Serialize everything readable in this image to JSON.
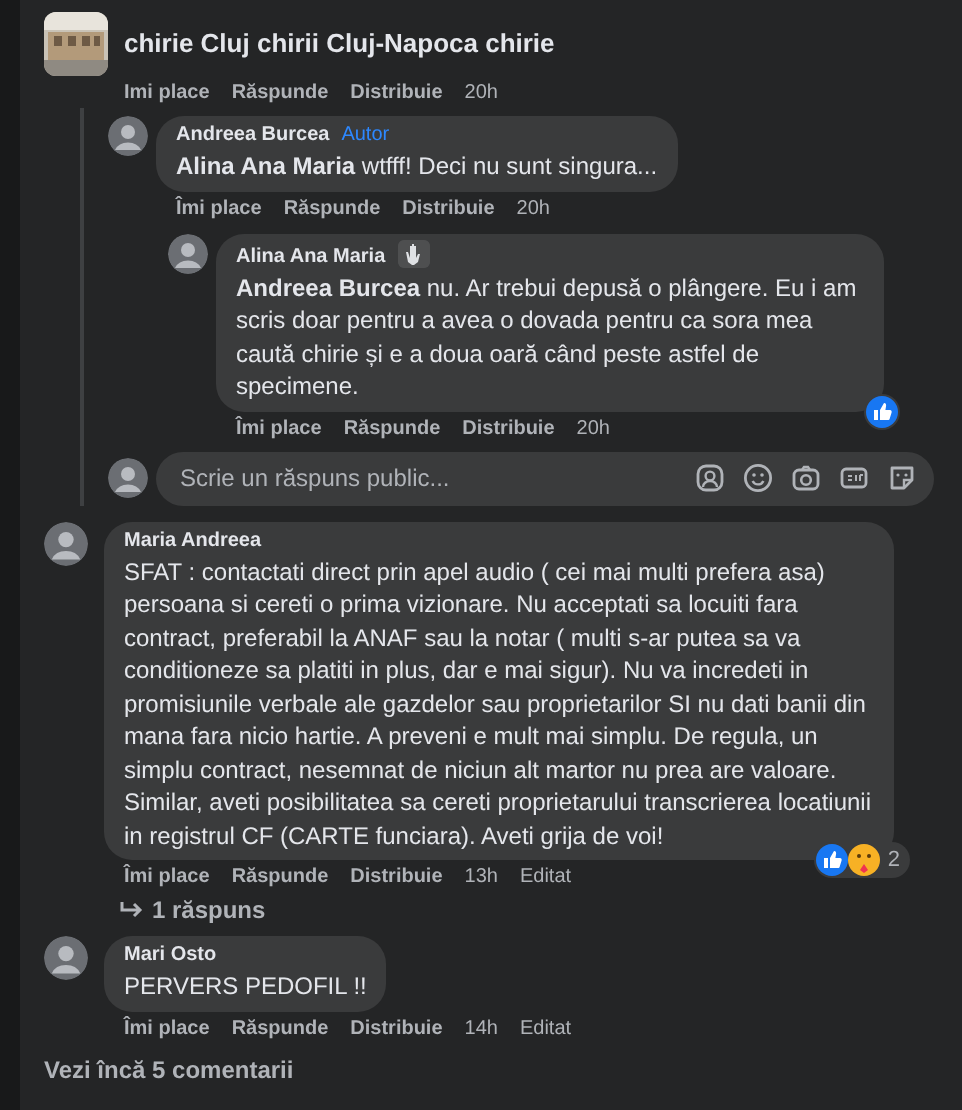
{
  "thread": {
    "author": "chirie Cluj chirii Cluj-Napoca chirie",
    "actions": {
      "like": "Imi place",
      "reply": "Răspunde",
      "share": "Distribuie",
      "time": "20h"
    },
    "replies": [
      {
        "author": "Andreea Burcea",
        "badge": {
          "kind": "author",
          "text": "Autor"
        },
        "text": "**Alina Ana Maria** wtfff! Deci nu sunt singura...",
        "actions": {
          "like": "Îmi place",
          "reply": "Răspunde",
          "share": "Distribuie",
          "time": "20h"
        }
      },
      {
        "author": "Alina Ana Maria",
        "badge": {
          "kind": "wave"
        },
        "text": "**Andreea Burcea** nu. Ar trebui depusă o plângere. Eu i am scris doar pentru a avea o dovada pentru ca sora mea caută chirie și e a doua oară când peste astfel de specimene.",
        "reactions": {
          "like": true
        },
        "actions": {
          "like": "Îmi place",
          "reply": "Răspunde",
          "share": "Distribuie",
          "time": "20h"
        }
      }
    ],
    "reply_box": {
      "placeholder": "Scrie un răspuns public..."
    }
  },
  "comments": [
    {
      "author": "Maria Andreea",
      "text": "SFAT : contactati direct prin apel audio ( cei mai multi prefera asa) persoana si cereti o prima vizionare. Nu acceptati sa locuiti fara contract, preferabil la ANAF sau la notar ( multi s-ar putea sa va conditioneze sa platiti in plus, dar e mai sigur). Nu va incredeti in promisiunile verbale ale gazdelor sau proprietarilor SI nu dati banii din mana fara nicio hartie. A preveni e mult mai simplu. De regula, un simplu contract, nesemnat de niciun alt martor nu prea are valoare. Similar, aveti posibilitatea sa cereti proprietarului transcrierea locatiunii in registrul CF (CARTE funciara). Aveti grija de voi!",
      "reactions": {
        "like": true,
        "care": true,
        "count": "2"
      },
      "actions": {
        "like": "Îmi place",
        "reply": "Răspunde",
        "share": "Distribuie",
        "time": "13h",
        "edited": "Editat"
      },
      "replies_link": "1 răspuns"
    },
    {
      "author": "Mari Osto",
      "text": "PERVERS PEDOFIL !!",
      "actions": {
        "like": "Îmi place",
        "reply": "Răspunde",
        "share": "Distribuie",
        "time": "14h",
        "edited": "Editat"
      }
    }
  ],
  "more_comments": "Vezi încă 5 comentarii"
}
